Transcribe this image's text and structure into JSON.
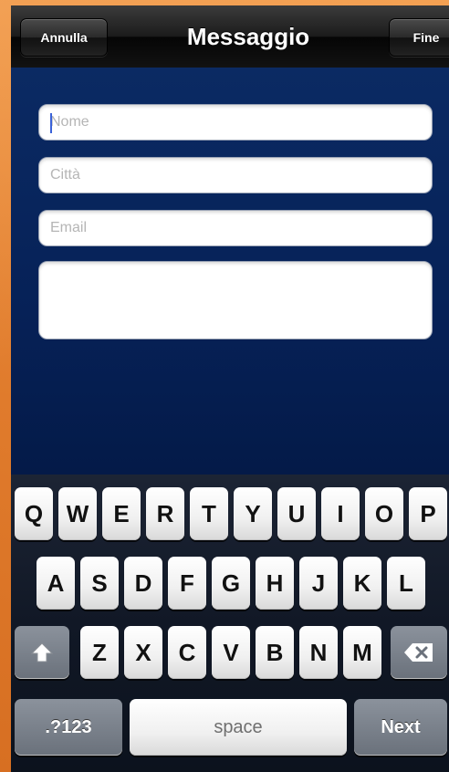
{
  "navbar": {
    "cancel_label": "Annulla",
    "title": "Messaggio",
    "done_label": "Fine"
  },
  "form": {
    "name_placeholder": "Nome",
    "city_placeholder": "Città",
    "email_placeholder": "Email",
    "message_value": ""
  },
  "keyboard": {
    "row1": [
      "Q",
      "W",
      "E",
      "R",
      "T",
      "Y",
      "U",
      "I",
      "O",
      "P"
    ],
    "row2": [
      "A",
      "S",
      "D",
      "F",
      "G",
      "H",
      "J",
      "K",
      "L"
    ],
    "row3": [
      "Z",
      "X",
      "C",
      "V",
      "B",
      "N",
      "M"
    ],
    "shift_icon": "shift-arrow-icon",
    "delete_icon": "backspace-icon",
    "numbers_label": ".?123",
    "space_label": "space",
    "next_label": "Next"
  },
  "colors": {
    "form_background": "#0a2457",
    "navbar": "#1b1b1b",
    "page_background": "#e8893a",
    "caret": "#3a62d8"
  }
}
